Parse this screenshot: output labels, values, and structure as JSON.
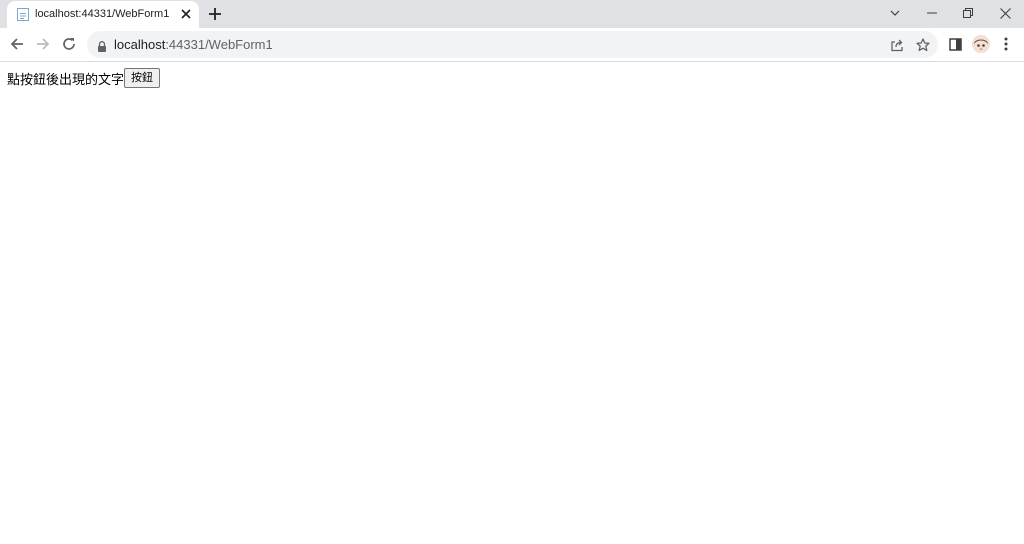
{
  "browser": {
    "tab": {
      "title": "localhost:44331/WebForm1"
    },
    "address_bar": {
      "host": "localhost",
      "rest": ":44331/WebForm1"
    }
  },
  "page": {
    "text": "點按鈕後出現的文字",
    "button_label": "按鈕"
  },
  "colors": {
    "tabstrip_bg": "#dfe1e5",
    "omnibox_bg": "#f1f3f4"
  },
  "icons": [
    "page-icon",
    "close-icon",
    "plus-icon",
    "chevron-down-icon",
    "minimize-icon",
    "restore-icon",
    "window-close-icon",
    "back-arrow-icon",
    "forward-arrow-icon",
    "reload-icon",
    "lock-icon",
    "share-icon",
    "star-icon",
    "side-panel-icon",
    "profile-avatar",
    "kebab-menu-icon"
  ]
}
